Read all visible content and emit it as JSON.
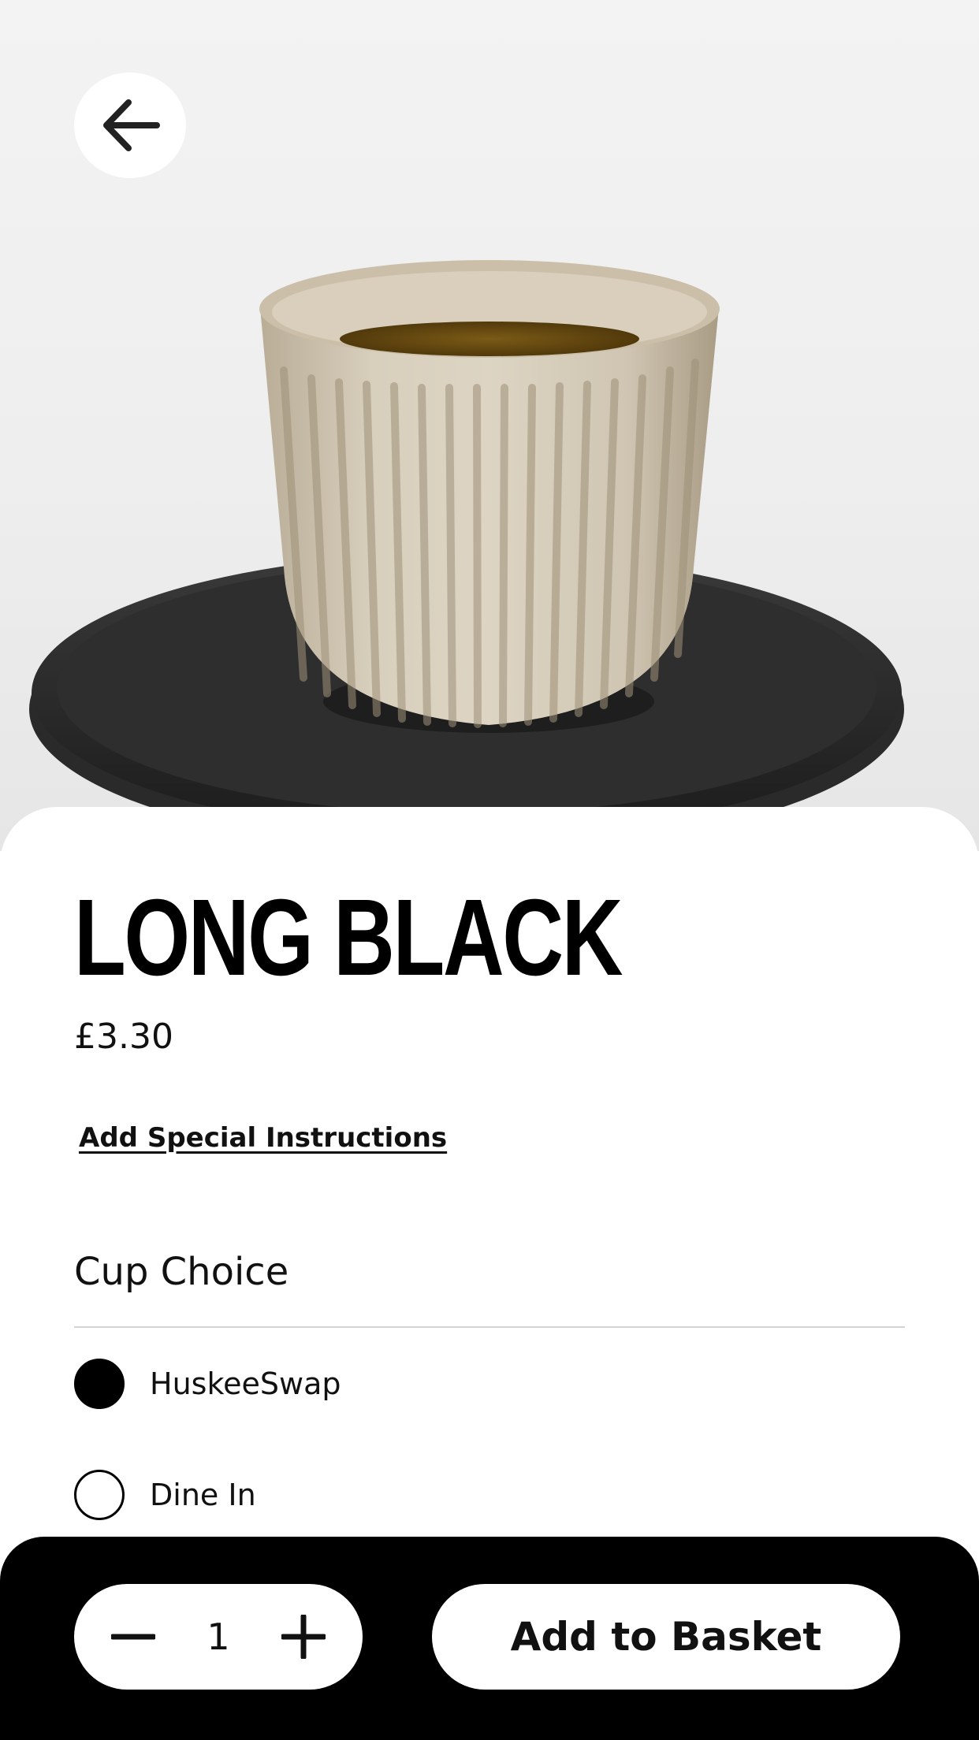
{
  "product": {
    "name": "LONG BLACK",
    "price": "£3.30",
    "image_icon": "huskee-cup-on-saucer-image"
  },
  "actions": {
    "special_instructions_label": "Add Special Instructions"
  },
  "cup_choice": {
    "title": "Cup Choice",
    "options": [
      {
        "label": "HuskeeSwap",
        "selected": true
      },
      {
        "label": "Dine In",
        "selected": false
      }
    ]
  },
  "footer": {
    "quantity": "1",
    "add_to_basket_label": "Add to Basket"
  },
  "icons": {
    "back": "arrow-left-icon",
    "decrement": "minus-icon",
    "increment": "plus-icon"
  },
  "colors": {
    "accent": "#000000",
    "surface": "#ffffff",
    "divider": "#d4d4d4"
  }
}
